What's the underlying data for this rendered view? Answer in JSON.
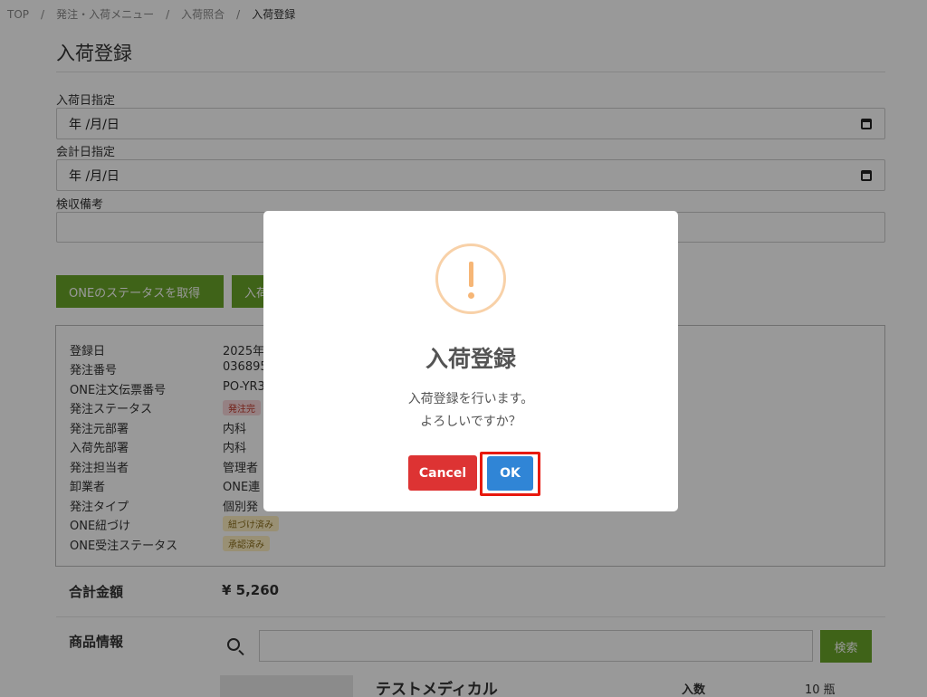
{
  "breadcrumb": {
    "items": [
      "TOP",
      "発注・入荷メニュー",
      "入荷照合"
    ],
    "current": "入荷登録",
    "separator": "/"
  },
  "page": {
    "title": "入荷登録"
  },
  "form": {
    "arrival_date_label": "入荷日指定",
    "arrival_date_value": "年 /月/日",
    "accounting_date_label": "会計日指定",
    "accounting_date_value": "年 /月/日",
    "inspection_note_label": "検収備考",
    "inspection_note_value": ""
  },
  "actions": {
    "get_status_label": "ONEのステータスを取得",
    "second_button_label": "入荷"
  },
  "info": {
    "rows": [
      {
        "label": "登録日",
        "value": "2025年"
      },
      {
        "label": "発注番号",
        "value": "036895"
      },
      {
        "label": "ONE注文伝票番号",
        "value": "PO-YR3"
      },
      {
        "label": "発注ステータス",
        "badge": "発注完",
        "badge_color": "red"
      },
      {
        "label": "発注元部署",
        "value": "内科"
      },
      {
        "label": "入荷先部署",
        "value": "内科"
      },
      {
        "label": "発注担当者",
        "value": "管理者"
      },
      {
        "label": "卸業者",
        "value": "ONE連"
      },
      {
        "label": "発注タイプ",
        "value": "個別発"
      },
      {
        "label": "ONE紐づけ",
        "badge": "紐づけ済み",
        "badge_color": "yellow"
      },
      {
        "label": "ONE受注ステータス",
        "badge": "承認済み",
        "badge_color": "yellow"
      }
    ]
  },
  "total": {
    "label": "合計金額",
    "value": "¥ 5,260"
  },
  "products": {
    "label": "商品情報",
    "search_placeholder": "",
    "search_button": "検索",
    "item": {
      "name": "テストメディカル",
      "qty_label": "入数",
      "qty_value": "10 瓶"
    }
  },
  "modal": {
    "icon": "warning-icon",
    "title": "入荷登録",
    "line1": "入荷登録を行います。",
    "line2": "よろしいですか？",
    "cancel_label": "Cancel",
    "ok_label": "OK"
  },
  "colors": {
    "green": "#6aa629",
    "cancel": "#dd3333",
    "ok": "#3085d6",
    "highlight": "#e8190e",
    "warning": "#f6b676"
  }
}
